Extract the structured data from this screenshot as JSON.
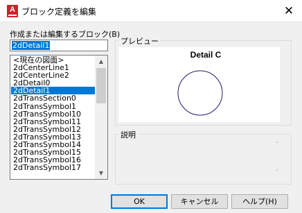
{
  "window": {
    "title": "ブロック定義を編集",
    "app_icon_letter": "A",
    "close_glyph": "✕"
  },
  "name_field": {
    "label": "作成または編集するブロック(B)",
    "value": "2dDetail1"
  },
  "block_list": {
    "items": [
      "<現在の図面>",
      "2dCenterLine1",
      "2dCenterLine2",
      "2dDetail0",
      "2dDetail1",
      "2dTransSection0",
      "2dTransSymbol1",
      "2dTransSymbol10",
      "2dTransSymbol11",
      "2dTransSymbol12",
      "2dTransSymbol13",
      "2dTransSymbol14",
      "2dTransSymbol15",
      "2dTransSymbol16",
      "2dTransSymbol17"
    ],
    "selected_index": 4,
    "scroll_up_glyph": "▲",
    "scroll_down_glyph": "▼"
  },
  "preview": {
    "group_title": "プレビュー",
    "block_label": "Detail C",
    "circle_color": "#1a1a6e"
  },
  "description": {
    "group_title": "説明",
    "text": "",
    "scroll_up_glyph": "⌃",
    "scroll_down_glyph": "⌄"
  },
  "buttons": {
    "ok": "OK",
    "cancel": "キャンセル",
    "help": "ヘルプ(H)"
  },
  "colors": {
    "accent": "#0078d7",
    "app_icon": "#d21f2b"
  }
}
